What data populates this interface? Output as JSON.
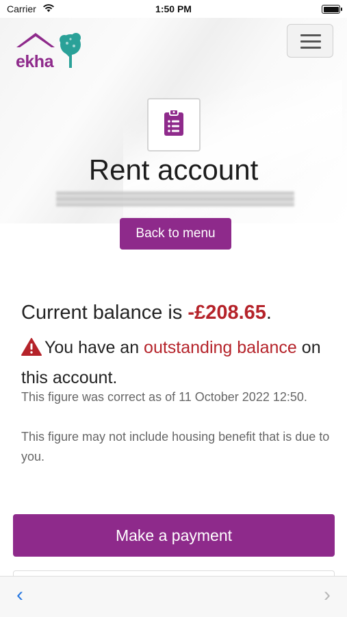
{
  "status_bar": {
    "carrier": "Carrier",
    "time": "1:50 PM"
  },
  "header": {
    "logo_text": "ekha",
    "menu_icon": "hamburger-icon"
  },
  "page": {
    "icon": "clipboard-list-icon",
    "title": "Rent account"
  },
  "actions": {
    "back_label": "Back to menu",
    "pay_label": "Make a payment"
  },
  "balance": {
    "prefix": "Current balance is ",
    "amount": "-£208.65",
    "suffix": ".",
    "warning_prefix": "You have an ",
    "warning_link": "outstanding balance",
    "warning_suffix": " on this account.",
    "note_correct": "This figure was correct as of 11 October 2022 12:50.",
    "note_benefit": "This figure may not include housing benefit that is due to you."
  },
  "toolbar": {
    "back_glyph": "‹",
    "forward_glyph": "›"
  },
  "colors": {
    "brand": "#8e2a8b",
    "alert": "#b5232a",
    "link": "#2a7ae2",
    "logo_tree": "#2aa198"
  }
}
